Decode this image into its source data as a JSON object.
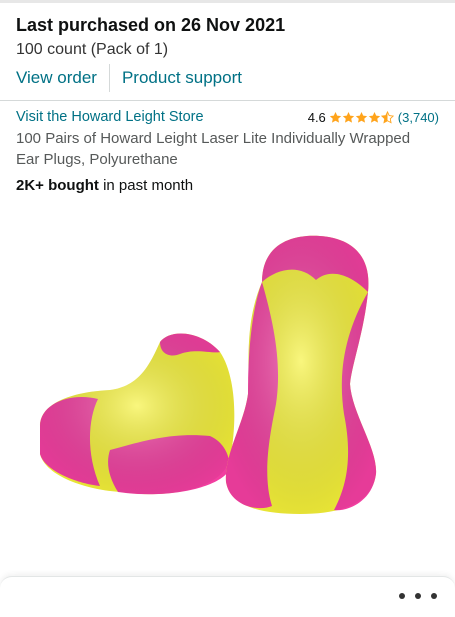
{
  "purchase": {
    "title": "Last purchased on 26 Nov 2021",
    "subtitle": "100 count (Pack of 1)"
  },
  "actions": {
    "view_order": "View order",
    "product_support": "Product support"
  },
  "product": {
    "store_link": "Visit the Howard Leight Store",
    "rating": "4.6",
    "stars": 4.6,
    "rating_count": "(3,740)",
    "title": "100 Pairs of Howard Leight Laser Lite Individually Wrapped Ear Plugs, Polyurethane",
    "bought_bold": "2K+ bought",
    "bought_rest": " in past month"
  },
  "image": {
    "icon": "earplugs-image",
    "colors": {
      "yellow": "#f4f233",
      "pink": "#f23ea0"
    }
  },
  "colors": {
    "link": "#007185",
    "star": "#ffa41c",
    "text": "#0f1111",
    "muted": "#565959"
  }
}
